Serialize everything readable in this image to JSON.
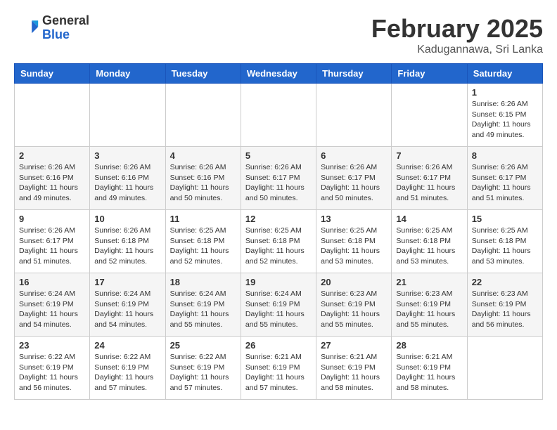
{
  "header": {
    "logo_line1": "General",
    "logo_line2": "Blue",
    "month_year": "February 2025",
    "location": "Kadugannawa, Sri Lanka"
  },
  "weekdays": [
    "Sunday",
    "Monday",
    "Tuesday",
    "Wednesday",
    "Thursday",
    "Friday",
    "Saturday"
  ],
  "weeks": [
    [
      {
        "day": "",
        "info": ""
      },
      {
        "day": "",
        "info": ""
      },
      {
        "day": "",
        "info": ""
      },
      {
        "day": "",
        "info": ""
      },
      {
        "day": "",
        "info": ""
      },
      {
        "day": "",
        "info": ""
      },
      {
        "day": "1",
        "info": "Sunrise: 6:26 AM\nSunset: 6:15 PM\nDaylight: 11 hours\nand 49 minutes."
      }
    ],
    [
      {
        "day": "2",
        "info": "Sunrise: 6:26 AM\nSunset: 6:16 PM\nDaylight: 11 hours\nand 49 minutes."
      },
      {
        "day": "3",
        "info": "Sunrise: 6:26 AM\nSunset: 6:16 PM\nDaylight: 11 hours\nand 49 minutes."
      },
      {
        "day": "4",
        "info": "Sunrise: 6:26 AM\nSunset: 6:16 PM\nDaylight: 11 hours\nand 50 minutes."
      },
      {
        "day": "5",
        "info": "Sunrise: 6:26 AM\nSunset: 6:17 PM\nDaylight: 11 hours\nand 50 minutes."
      },
      {
        "day": "6",
        "info": "Sunrise: 6:26 AM\nSunset: 6:17 PM\nDaylight: 11 hours\nand 50 minutes."
      },
      {
        "day": "7",
        "info": "Sunrise: 6:26 AM\nSunset: 6:17 PM\nDaylight: 11 hours\nand 51 minutes."
      },
      {
        "day": "8",
        "info": "Sunrise: 6:26 AM\nSunset: 6:17 PM\nDaylight: 11 hours\nand 51 minutes."
      }
    ],
    [
      {
        "day": "9",
        "info": "Sunrise: 6:26 AM\nSunset: 6:17 PM\nDaylight: 11 hours\nand 51 minutes."
      },
      {
        "day": "10",
        "info": "Sunrise: 6:26 AM\nSunset: 6:18 PM\nDaylight: 11 hours\nand 52 minutes."
      },
      {
        "day": "11",
        "info": "Sunrise: 6:25 AM\nSunset: 6:18 PM\nDaylight: 11 hours\nand 52 minutes."
      },
      {
        "day": "12",
        "info": "Sunrise: 6:25 AM\nSunset: 6:18 PM\nDaylight: 11 hours\nand 52 minutes."
      },
      {
        "day": "13",
        "info": "Sunrise: 6:25 AM\nSunset: 6:18 PM\nDaylight: 11 hours\nand 53 minutes."
      },
      {
        "day": "14",
        "info": "Sunrise: 6:25 AM\nSunset: 6:18 PM\nDaylight: 11 hours\nand 53 minutes."
      },
      {
        "day": "15",
        "info": "Sunrise: 6:25 AM\nSunset: 6:18 PM\nDaylight: 11 hours\nand 53 minutes."
      }
    ],
    [
      {
        "day": "16",
        "info": "Sunrise: 6:24 AM\nSunset: 6:19 PM\nDaylight: 11 hours\nand 54 minutes."
      },
      {
        "day": "17",
        "info": "Sunrise: 6:24 AM\nSunset: 6:19 PM\nDaylight: 11 hours\nand 54 minutes."
      },
      {
        "day": "18",
        "info": "Sunrise: 6:24 AM\nSunset: 6:19 PM\nDaylight: 11 hours\nand 55 minutes."
      },
      {
        "day": "19",
        "info": "Sunrise: 6:24 AM\nSunset: 6:19 PM\nDaylight: 11 hours\nand 55 minutes."
      },
      {
        "day": "20",
        "info": "Sunrise: 6:23 AM\nSunset: 6:19 PM\nDaylight: 11 hours\nand 55 minutes."
      },
      {
        "day": "21",
        "info": "Sunrise: 6:23 AM\nSunset: 6:19 PM\nDaylight: 11 hours\nand 55 minutes."
      },
      {
        "day": "22",
        "info": "Sunrise: 6:23 AM\nSunset: 6:19 PM\nDaylight: 11 hours\nand 56 minutes."
      }
    ],
    [
      {
        "day": "23",
        "info": "Sunrise: 6:22 AM\nSunset: 6:19 PM\nDaylight: 11 hours\nand 56 minutes."
      },
      {
        "day": "24",
        "info": "Sunrise: 6:22 AM\nSunset: 6:19 PM\nDaylight: 11 hours\nand 57 minutes."
      },
      {
        "day": "25",
        "info": "Sunrise: 6:22 AM\nSunset: 6:19 PM\nDaylight: 11 hours\nand 57 minutes."
      },
      {
        "day": "26",
        "info": "Sunrise: 6:21 AM\nSunset: 6:19 PM\nDaylight: 11 hours\nand 57 minutes."
      },
      {
        "day": "27",
        "info": "Sunrise: 6:21 AM\nSunset: 6:19 PM\nDaylight: 11 hours\nand 58 minutes."
      },
      {
        "day": "28",
        "info": "Sunrise: 6:21 AM\nSunset: 6:19 PM\nDaylight: 11 hours\nand 58 minutes."
      },
      {
        "day": "",
        "info": ""
      }
    ]
  ]
}
